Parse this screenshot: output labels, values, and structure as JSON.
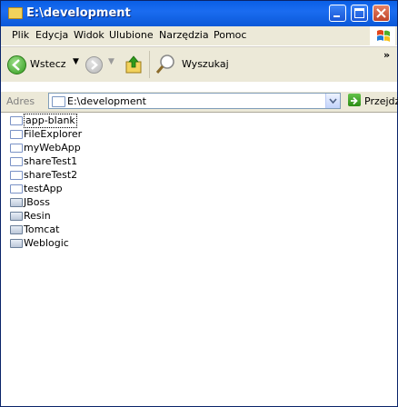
{
  "window": {
    "title": "E:\\development"
  },
  "menu": [
    "Plik",
    "Edycja",
    "Widok",
    "Ulubione",
    "Narzędzia",
    "Pomoc"
  ],
  "toolbar": {
    "back_label": "Wstecz",
    "search_label": "Wyszukaj",
    "more": "»"
  },
  "address": {
    "label": "Adres",
    "value": "E:\\development",
    "go_label": "Przejdź"
  },
  "items": [
    {
      "label": "app-blank",
      "kind": "folder",
      "selected": true
    },
    {
      "label": "FileExplorer",
      "kind": "folder"
    },
    {
      "label": "myWebApp",
      "kind": "folder"
    },
    {
      "label": "shareTest1",
      "kind": "folder"
    },
    {
      "label": "shareTest2",
      "kind": "folder"
    },
    {
      "label": "testApp",
      "kind": "folder"
    },
    {
      "label": "JBoss",
      "kind": "server"
    },
    {
      "label": "Resin",
      "kind": "server"
    },
    {
      "label": "Tomcat",
      "kind": "server"
    },
    {
      "label": "Weblogic",
      "kind": "server"
    }
  ],
  "icons": {
    "title": "folder-icon",
    "back": "back-arrow-icon",
    "forward": "forward-arrow-icon",
    "up": "folder-up-icon",
    "search": "search-icon",
    "address": "folder-icon",
    "go": "go-arrow-icon",
    "xp": "windows-logo-icon"
  },
  "colors": {
    "title_bar": "#0a5fe6",
    "chrome": "#ece9d8"
  }
}
